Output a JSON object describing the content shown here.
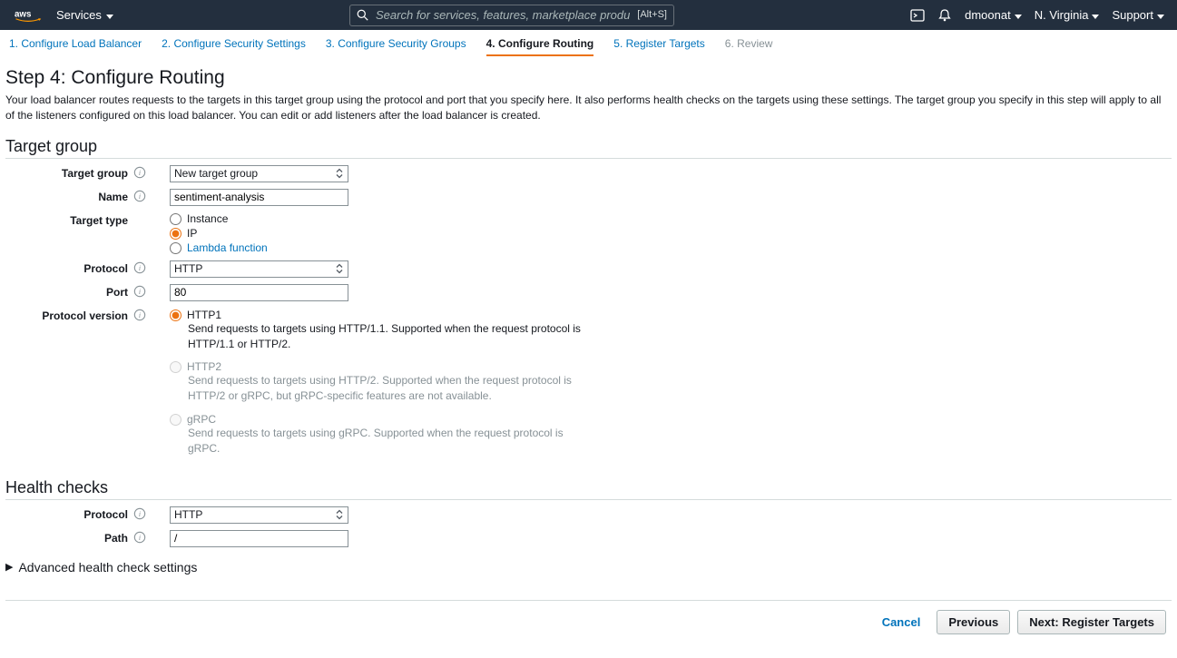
{
  "nav": {
    "services": "Services",
    "search_placeholder": "Search for services, features, marketplace products, and docs",
    "search_kbd": "[Alt+S]",
    "user": "dmoonat",
    "region": "N. Virginia",
    "support": "Support"
  },
  "tabs": [
    {
      "label": "1. Configure Load Balancer"
    },
    {
      "label": "2. Configure Security Settings"
    },
    {
      "label": "3. Configure Security Groups"
    },
    {
      "label": "4. Configure Routing"
    },
    {
      "label": "5. Register Targets"
    },
    {
      "label": "6. Review"
    }
  ],
  "step": {
    "title": "Step 4: Configure Routing",
    "desc": "Your load balancer routes requests to the targets in this target group using the protocol and port that you specify here. It also performs health checks on the targets using these settings. The target group you specify in this step will apply to all of the listeners configured on this load balancer. You can edit or add listeners after the load balancer is created."
  },
  "section_target_group": "Target group",
  "section_health_checks": "Health checks",
  "labels": {
    "target_group": "Target group",
    "name": "Name",
    "target_type": "Target type",
    "protocol": "Protocol",
    "port": "Port",
    "protocol_version": "Protocol version",
    "hc_protocol": "Protocol",
    "path": "Path",
    "advanced": "Advanced health check settings"
  },
  "values": {
    "target_group_select": "New target group",
    "name": "sentiment-analysis",
    "protocol": "HTTP",
    "port": "80",
    "hc_protocol": "HTTP",
    "path": "/"
  },
  "target_type": {
    "instance": "Instance",
    "ip": "IP",
    "lambda": "Lambda function"
  },
  "protocol_version": {
    "http1_label": "HTTP1",
    "http1_desc": "Send requests to targets using HTTP/1.1. Supported when the request protocol is HTTP/1.1 or HTTP/2.",
    "http2_label": "HTTP2",
    "http2_desc": "Send requests to targets using HTTP/2. Supported when the request protocol is HTTP/2 or gRPC, but gRPC-specific features are not available.",
    "grpc_label": "gRPC",
    "grpc_desc": "Send requests to targets using gRPC. Supported when the request protocol is gRPC."
  },
  "footer": {
    "cancel": "Cancel",
    "previous": "Previous",
    "next": "Next: Register Targets"
  }
}
